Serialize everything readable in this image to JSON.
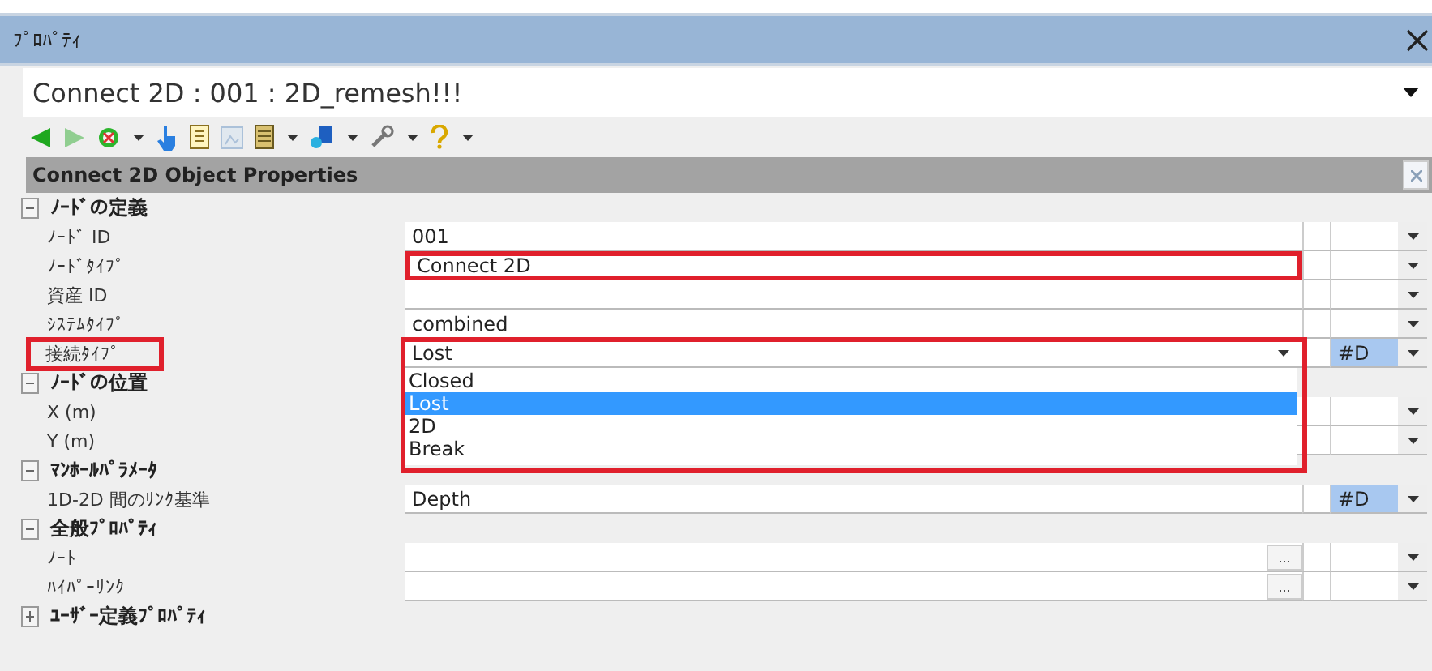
{
  "window": {
    "title": "ﾌﾟﾛﾊﾟﾃｨ"
  },
  "object_selector": {
    "value": "Connect 2D : 001 : 2D_remesh!!!"
  },
  "toolbar": [
    {
      "kind": "back",
      "disabled": false,
      "menu": false
    },
    {
      "kind": "forward",
      "disabled": true,
      "menu": false
    },
    {
      "kind": "target",
      "disabled": false,
      "menu": true
    },
    {
      "kind": "pointer",
      "disabled": false,
      "menu": false
    },
    {
      "kind": "document",
      "disabled": false,
      "menu": false
    },
    {
      "kind": "frame",
      "disabled": true,
      "menu": false
    },
    {
      "kind": "list",
      "disabled": false,
      "menu": true
    },
    {
      "kind": "shapes",
      "disabled": false,
      "menu": true
    },
    {
      "kind": "wrench",
      "disabled": false,
      "menu": true
    },
    {
      "kind": "help",
      "disabled": false,
      "menu": true
    }
  ],
  "panel": {
    "title": "Connect 2D Object Properties"
  },
  "categories": [
    {
      "label": "ﾉｰﾄﾞの定義",
      "expanded": true,
      "children": [
        {
          "label": "ﾉｰﾄﾞ ID",
          "kind": "text",
          "value": "001",
          "label_highlighted": false,
          "value_highlighted": false
        },
        {
          "label": "ﾉｰﾄﾞﾀｲﾌﾟ",
          "kind": "text",
          "value": "Connect 2D",
          "label_highlighted": false,
          "value_highlighted": true
        },
        {
          "label": "資産 ID",
          "kind": "text",
          "label_highlighted": false,
          "value_highlighted": false
        },
        {
          "label": "ｼｽﾃﾑﾀｲﾌﾟ",
          "kind": "text",
          "value": "combined",
          "label_highlighted": false,
          "value_highlighted": false
        },
        {
          "label": "接続ﾀｲﾌﾟ",
          "kind": "open_combo",
          "value": "Lost",
          "flag": "#D",
          "label_highlighted": true,
          "value_highlighted": true,
          "options": [
            {
              "label": "Closed",
              "selected": false
            },
            {
              "label": "Lost",
              "selected": true
            },
            {
              "label": "2D",
              "selected": false
            },
            {
              "label": "Break",
              "selected": false
            }
          ]
        }
      ]
    },
    {
      "label": "ﾉｰﾄﾞの位置",
      "expanded": true,
      "children": [
        {
          "label": "X (m)",
          "kind": "covered",
          "label_highlighted": false,
          "value_highlighted": false
        },
        {
          "label": "Y (m)",
          "kind": "covered",
          "label_highlighted": false,
          "value_highlighted": false
        }
      ]
    },
    {
      "label": "ﾏﾝﾎｰﾙﾊﾟﾗﾒｰﾀ",
      "expanded": true,
      "children": [
        {
          "label": "1D-2D 間のﾘﾝｸ基準",
          "kind": "text",
          "value": "Depth",
          "flag": "#D",
          "label_highlighted": false,
          "value_highlighted": false
        }
      ]
    },
    {
      "label": "全般ﾌﾟﾛﾊﾟﾃｨ",
      "expanded": true,
      "children": [
        {
          "label": "ﾉｰﾄ",
          "kind": "ellipsis",
          "button_text": "...",
          "label_highlighted": false,
          "value_highlighted": false
        },
        {
          "label": "ﾊｲﾊﾟｰﾘﾝｸ",
          "kind": "ellipsis",
          "button_text": "...",
          "label_highlighted": false,
          "value_highlighted": false
        }
      ]
    },
    {
      "label": "ﾕｰｻﾞｰ定義ﾌﾟﾛﾊﾟﾃｨ",
      "expanded": false
    }
  ]
}
